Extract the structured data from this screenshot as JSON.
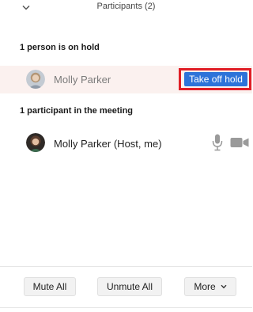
{
  "header": {
    "title": "Participants (2)",
    "collapse_icon": "chevron-down-icon"
  },
  "on_hold": {
    "title": "1 person is on hold",
    "participant": {
      "name": "Molly Parker",
      "action_label": "Take off hold",
      "highlight_color": "#e01e26"
    }
  },
  "in_meeting": {
    "title": "1 participant in the meeting",
    "participants": [
      {
        "name": "Molly Parker (Host, me)",
        "mic_icon": "microphone-icon",
        "video_icon": "video-camera-icon"
      }
    ]
  },
  "footer": {
    "mute_all_label": "Mute All",
    "unmute_all_label": "Unmute All",
    "more_label": "More"
  },
  "colors": {
    "accent_blue": "#2d73d9",
    "hold_row_bg": "#fbf1ef",
    "highlight_red": "#e01e26"
  }
}
